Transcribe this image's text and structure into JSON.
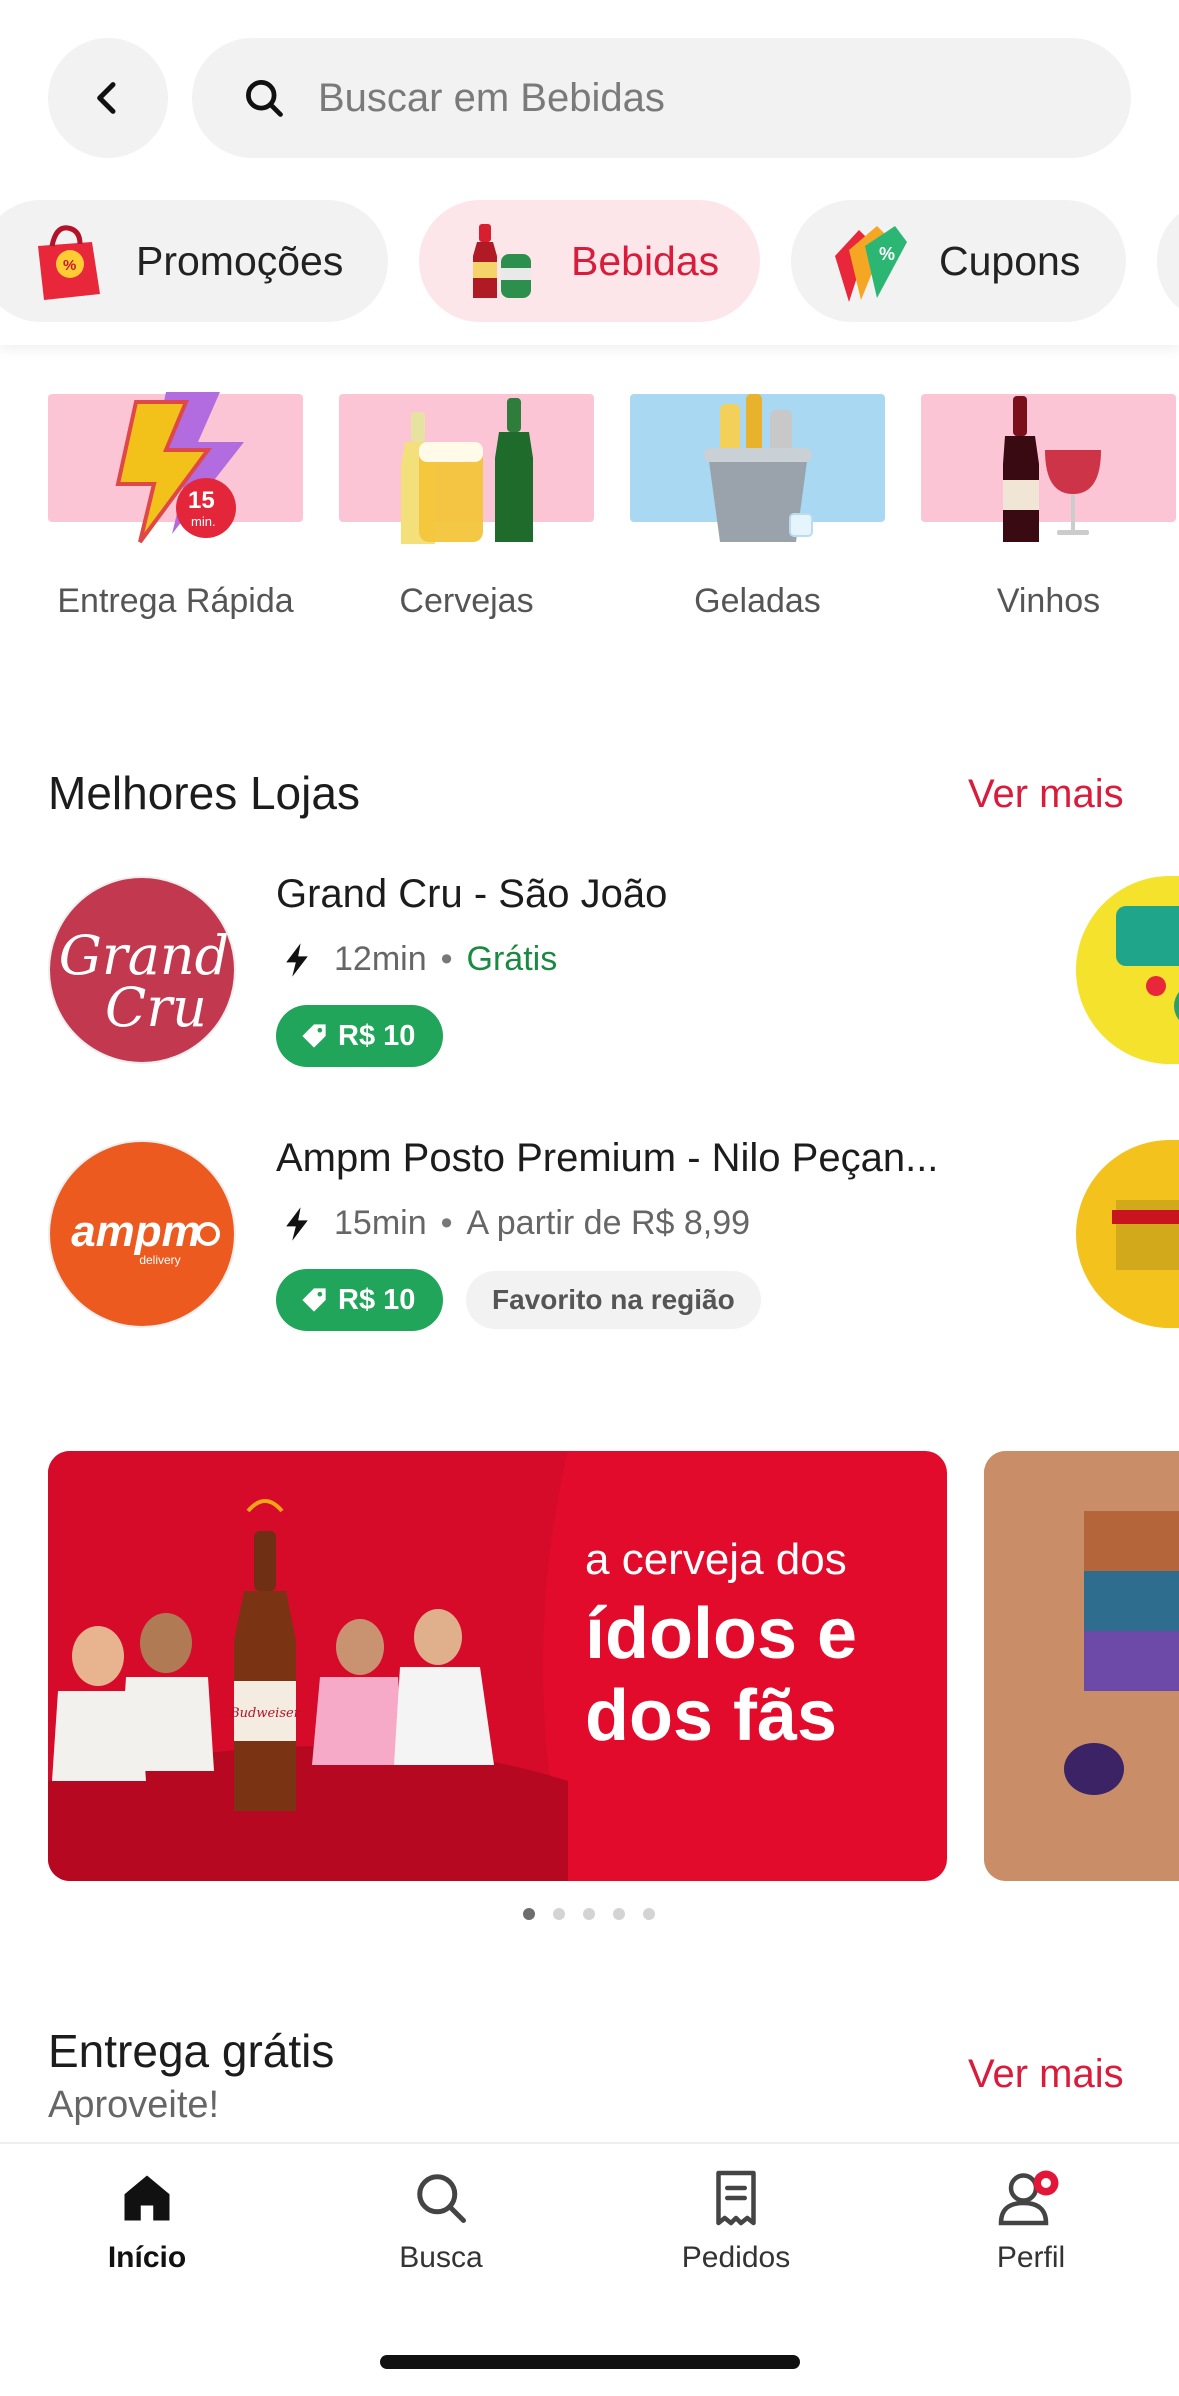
{
  "search": {
    "placeholder": "Buscar em Bebidas"
  },
  "chips": [
    {
      "label": "Promoções",
      "active": false
    },
    {
      "label": "Bebidas",
      "active": true
    },
    {
      "label": "Cupons",
      "active": false
    }
  ],
  "categories": [
    {
      "name": "Entrega Rápida",
      "bg": "#fcc5d6"
    },
    {
      "name": "Cervejas",
      "bg": "#fcc5d6"
    },
    {
      "name": "Geladas",
      "bg": "#a9d8f2"
    },
    {
      "name": "Vinhos",
      "bg": "#fcc5d6"
    }
  ],
  "lojas": {
    "title": "Melhores Lojas",
    "ver_mais": "Ver mais",
    "items": [
      {
        "name": "Grand Cru - São João",
        "logo_text_1": "Grand",
        "logo_text_2": "Cru",
        "time": "12min",
        "delivery": "Grátis",
        "coupon": "R$ 10",
        "tag": ""
      },
      {
        "name": "Ampm Posto Premium - Nilo Peçan...",
        "logo_text_1": "ampm",
        "logo_text_2": "delivery",
        "time": "15min",
        "delivery": "A partir de R$ 8,99",
        "coupon": "R$ 10",
        "tag": "Favorito na região"
      }
    ]
  },
  "banner": {
    "line1": "a cerveja dos",
    "line2": "ídolos e dos fãs",
    "brand": "Budweiser"
  },
  "entrega": {
    "title": "Entrega grátis",
    "subtitle": "Aproveite!",
    "ver_mais": "Ver mais"
  },
  "nav": [
    {
      "label": "Início",
      "icon": "home-icon",
      "active": true
    },
    {
      "label": "Busca",
      "icon": "search-icon",
      "active": false
    },
    {
      "label": "Pedidos",
      "icon": "receipt-icon",
      "active": false
    },
    {
      "label": "Perfil",
      "icon": "user-icon",
      "active": false
    }
  ],
  "colors": {
    "accent": "#d81c3b",
    "green": "#21a55a",
    "chip_bg": "#f2f2f2"
  }
}
